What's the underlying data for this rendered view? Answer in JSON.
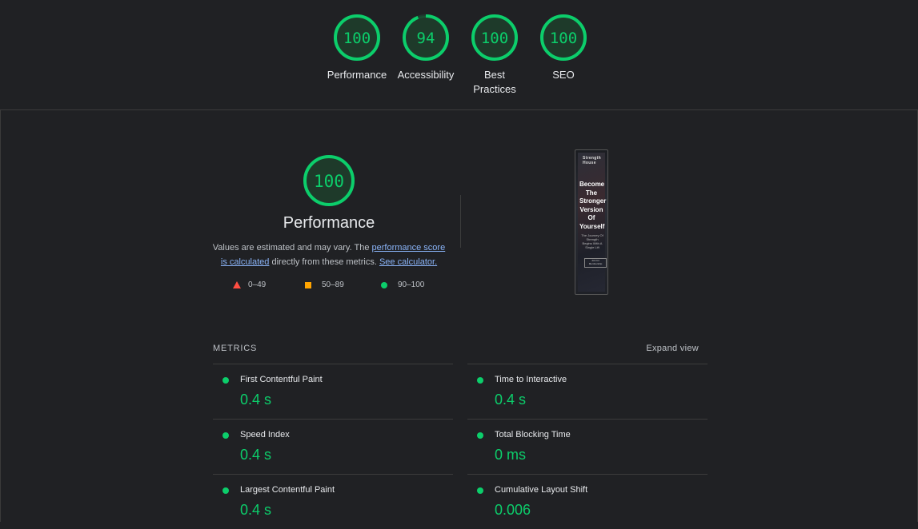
{
  "colors": {
    "pass": "#0cce6b",
    "average": "#ffa400",
    "fail": "#ff4e42",
    "background": "#202124"
  },
  "summary_gauges": [
    {
      "score": "100",
      "label": "Performance",
      "fraction": 1.0
    },
    {
      "score": "94",
      "label": "Accessibility",
      "fraction": 0.94
    },
    {
      "score": "100",
      "label": "Best Practices",
      "fraction": 1.0
    },
    {
      "score": "100",
      "label": "SEO",
      "fraction": 1.0
    }
  ],
  "performance": {
    "score": "100",
    "fraction": 1.0,
    "title": "Performance",
    "desc_prefix": "Values are estimated and may vary. The ",
    "desc_link1": "performance score is calculated",
    "desc_middle": " directly from these metrics. ",
    "desc_link2": "See calculator."
  },
  "legend": {
    "fail": "0–49",
    "average": "50–89",
    "pass": "90–100"
  },
  "screenshot": {
    "brand": "Strength House",
    "headline": "Become The Stronger Version Of Yourself",
    "sub": "The Journey Of Strength Begins With A Single Lift",
    "button": "Join for Membership"
  },
  "metrics": {
    "header": "METRICS",
    "expand_label": "Expand view",
    "items": [
      {
        "title": "First Contentful Paint",
        "value": "0.4 s"
      },
      {
        "title": "Time to Interactive",
        "value": "0.4 s"
      },
      {
        "title": "Speed Index",
        "value": "0.4 s"
      },
      {
        "title": "Total Blocking Time",
        "value": "0 ms"
      },
      {
        "title": "Largest Contentful Paint",
        "value": "0.4 s"
      },
      {
        "title": "Cumulative Layout Shift",
        "value": "0.006"
      }
    ]
  }
}
